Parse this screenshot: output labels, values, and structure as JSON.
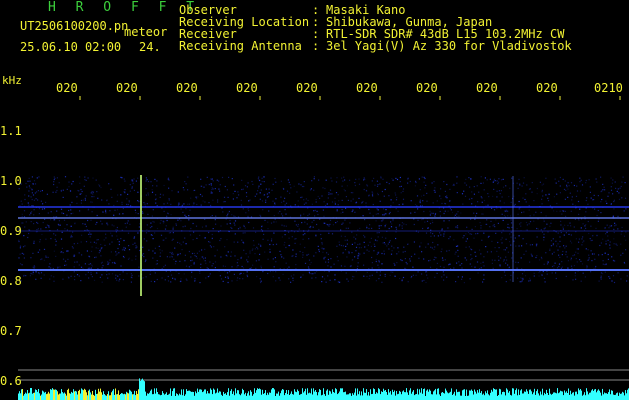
{
  "header": {
    "app_title": "H R O F F T",
    "file_name": "UT2506100200.pn",
    "tag": "meteor",
    "date_time": "25.06.10 02:00",
    "count": "24.",
    "info": [
      {
        "label": "Observer",
        "value": "Masaki Kano"
      },
      {
        "label": "Receiving Location",
        "value": "Shibukawa, Gunma, Japan"
      },
      {
        "label": "Receiver",
        "value": "RTL-SDR SDR# 43dB L15 103.2MHz CW"
      },
      {
        "label": "Receiving Antenna",
        "value": "3el Yagi(V) Az 330 for Vladivostok"
      }
    ],
    "colon": ":"
  },
  "axis": {
    "unit": "kHz",
    "time_labels": [
      "020",
      "020",
      "020",
      "020",
      "020",
      "020",
      "020",
      "020",
      "020",
      "0210"
    ],
    "freq_labels": [
      "1.1",
      "1.0",
      "0.9",
      "0.8",
      "0.7",
      "0.6"
    ]
  },
  "colors": {
    "background": "#000000",
    "signal": "#2a3dff",
    "label_yellow": "#f2f233",
    "title_green": "#3ccf3c",
    "bottom_cyan": "#33ffff"
  }
}
